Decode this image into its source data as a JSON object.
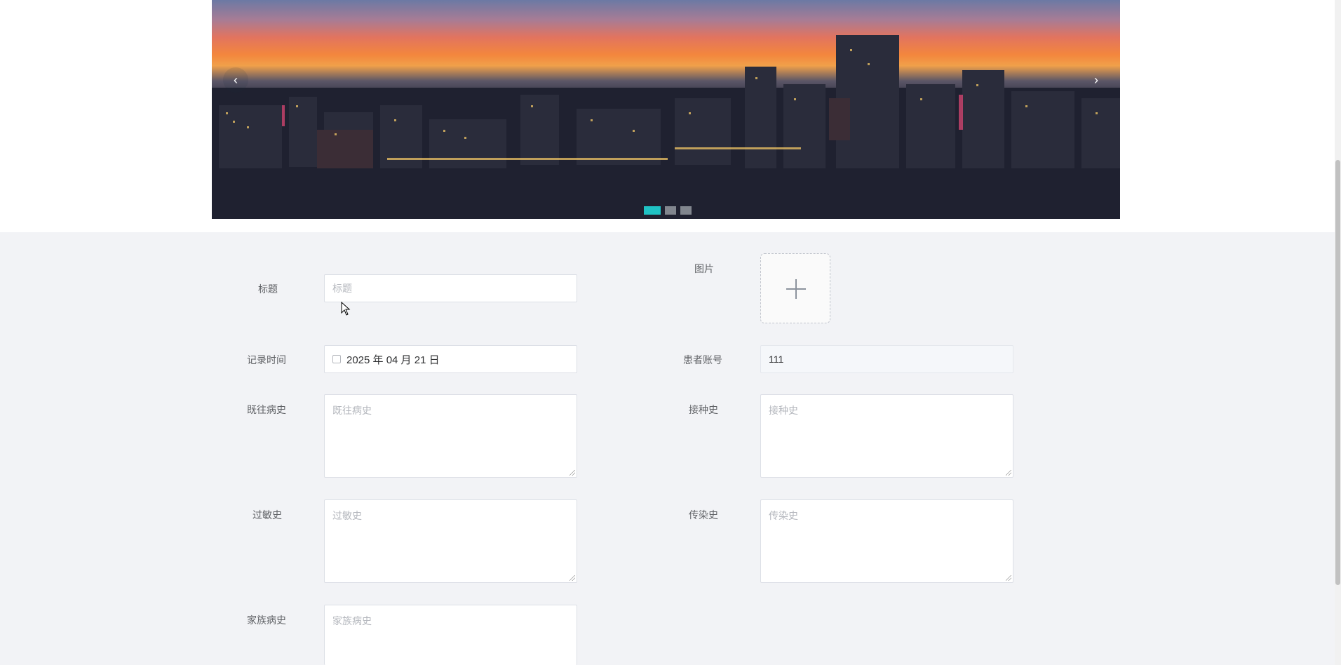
{
  "carousel": {
    "prev_glyph": "‹",
    "next_glyph": "›",
    "slide_count": 3,
    "active_slide": 1
  },
  "form": {
    "title": {
      "label": "标题",
      "placeholder": "标题",
      "value": ""
    },
    "image": {
      "label": "图片",
      "icon": "plus-icon"
    },
    "record_time": {
      "label": "记录时间",
      "value": "2025 年 04 月 21 日",
      "icon": "calendar-icon"
    },
    "patient_account": {
      "label": "患者账号",
      "value": "111"
    },
    "past_history": {
      "label": "既往病史",
      "placeholder": "既往病史"
    },
    "vaccination_history": {
      "label": "接种史",
      "placeholder": "接种史"
    },
    "allergy_history": {
      "label": "过敏史",
      "placeholder": "过敏史"
    },
    "infection_history": {
      "label": "传染史",
      "placeholder": "传染史"
    },
    "family_history": {
      "label": "家族病史",
      "placeholder": "家族病史"
    }
  },
  "colors": {
    "page_bg": "#f2f3f6",
    "indicator_active": "#1fc2c4",
    "border": "#dcdfe6",
    "label": "#606266"
  }
}
